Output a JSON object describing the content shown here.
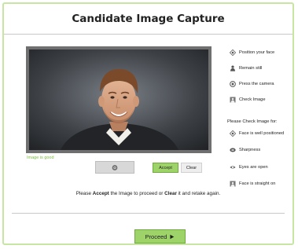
{
  "header": {
    "title": "Candidate Image Capture"
  },
  "capture": {
    "status": "Image is good",
    "camera_icon": "camera-icon",
    "accept_label": "Accept",
    "clear_label": "Clear"
  },
  "steps": [
    {
      "icon": "position-icon",
      "label": "Position your face"
    },
    {
      "icon": "person-icon",
      "label": "Remain still"
    },
    {
      "icon": "camera-icon",
      "label": "Press the camera"
    },
    {
      "icon": "image-icon",
      "label": "Check Image"
    }
  ],
  "checks": {
    "title": "Please Check Image for:",
    "items": [
      {
        "icon": "position-icon",
        "label": "Face is well positioned"
      },
      {
        "icon": "sharpness-icon",
        "label": "Sharpness"
      },
      {
        "icon": "eye-icon",
        "label": "Eyes are open"
      },
      {
        "icon": "image-icon",
        "label": "Face is straight on"
      }
    ]
  },
  "instructions": {
    "prefix": "Please ",
    "accept_word": "Accept",
    "middle": " the Image to proceed or ",
    "clear_word": "Clear",
    "suffix": " it and retake again."
  },
  "footer": {
    "proceed_label": "Proceed",
    "proceed_icon": "play-icon"
  },
  "colors": {
    "accent": "#9ed36a",
    "status_good": "#7bbf3a",
    "frame": "#c7e5a3"
  }
}
